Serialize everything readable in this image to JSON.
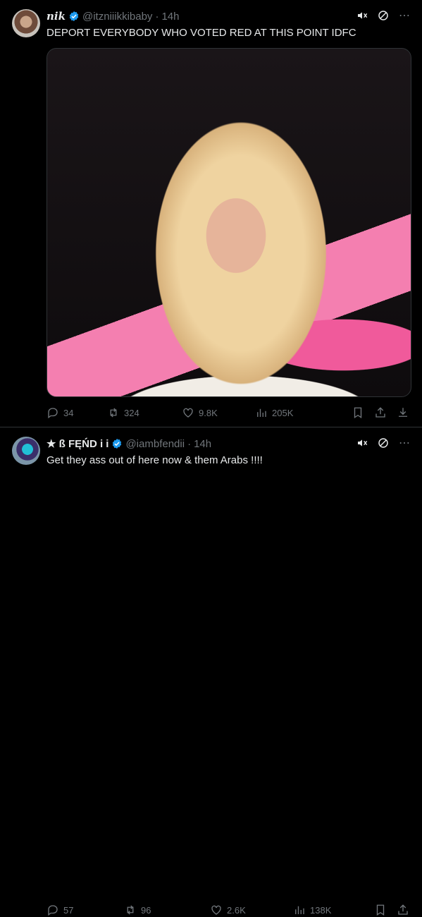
{
  "tweets": [
    {
      "display_name": "𝒏𝒊𝒌",
      "handle": "@itzniiikkibaby",
      "separator": "·",
      "time": "14h",
      "text": "DEPORT EVERYBODY WHO VOTED RED AT THIS POINT IDFC",
      "has_media": true,
      "stats": {
        "replies": "34",
        "reposts": "324",
        "likes": "9.8K",
        "views": "205K"
      }
    },
    {
      "display_name": "★ ß FĘŃD i i",
      "handle": "@iambfendii",
      "separator": "·",
      "time": "14h",
      "text": "Get they ass out of here now & them Arabs !!!!",
      "has_media": false,
      "stats": {
        "replies": "57",
        "reposts": "96",
        "likes": "2.6K",
        "views": "138K"
      }
    }
  ],
  "colors": {
    "background": "#000000",
    "text": "#e7e9ea",
    "muted": "#71767b",
    "verified": "#1d9bf0",
    "divider": "#2f3336"
  },
  "icons": [
    "mute-icon",
    "block-icon",
    "more-icon",
    "reply-icon",
    "repost-icon",
    "like-icon",
    "views-icon",
    "bookmark-icon",
    "share-icon",
    "download-icon"
  ]
}
